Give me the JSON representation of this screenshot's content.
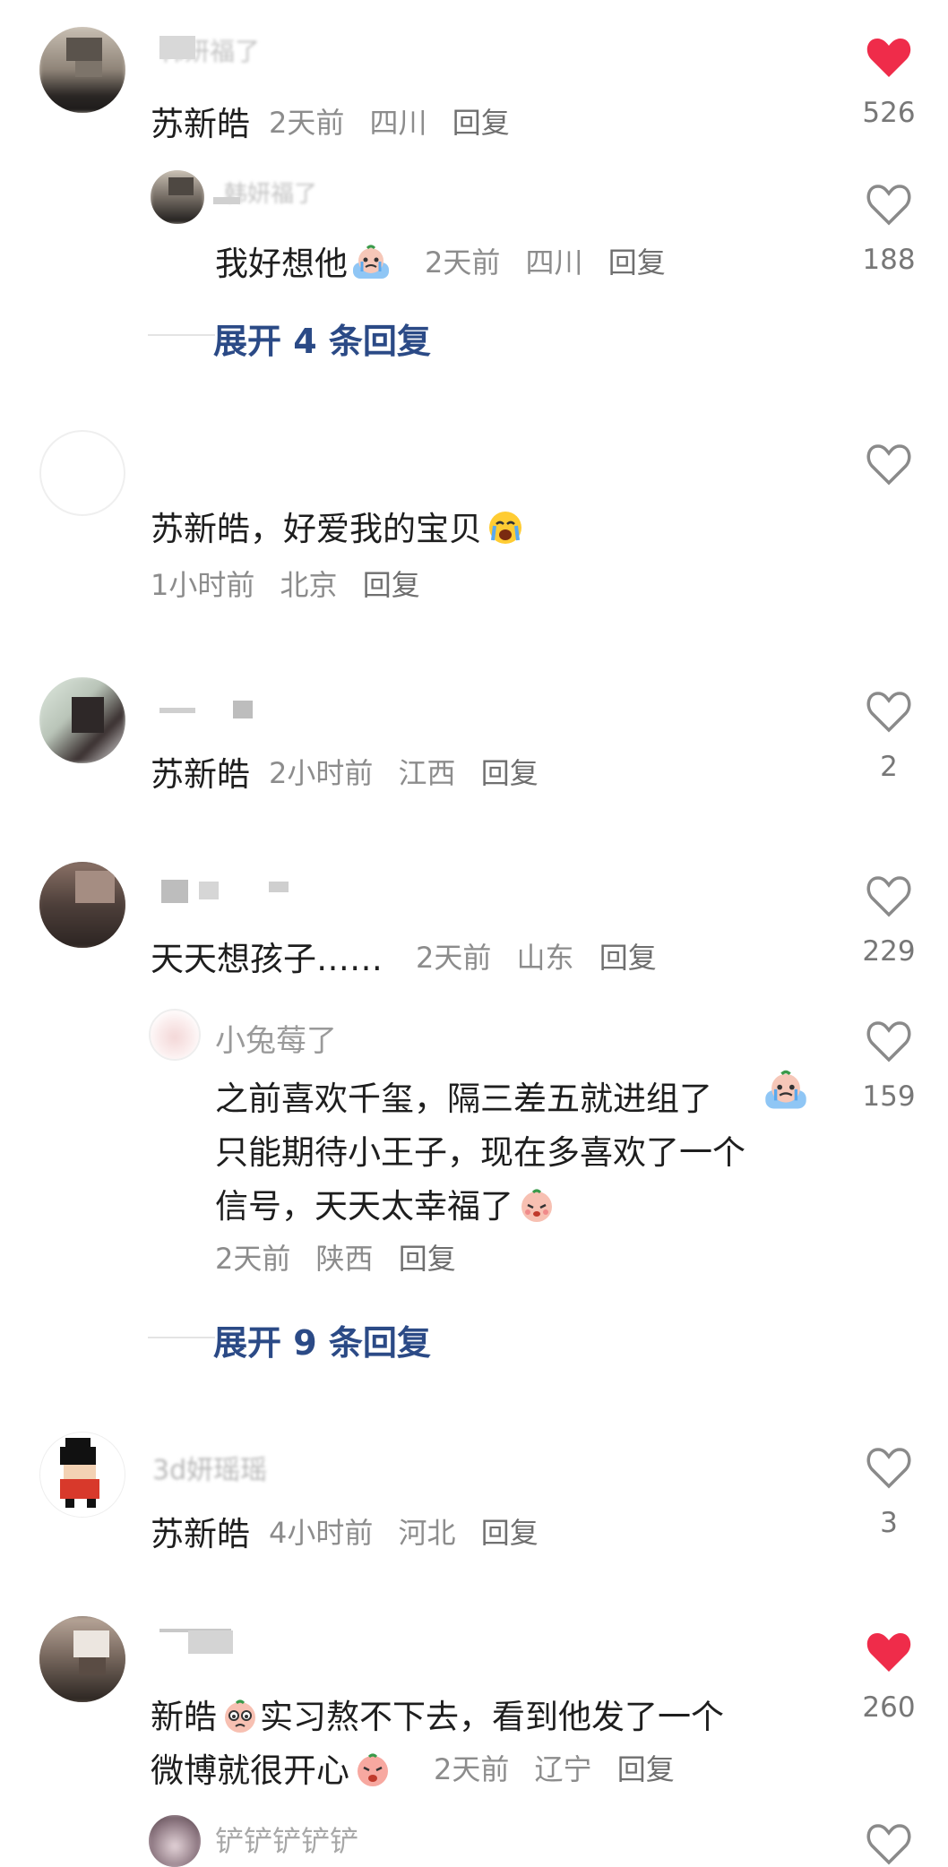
{
  "comments": [
    {
      "username": "韩妍福了",
      "text": "苏新皓",
      "time": "2天前",
      "location": "四川",
      "reply": "回复",
      "likes": "526",
      "liked": true,
      "replies": [
        {
          "username": "韩妍福了",
          "text": "我好想他",
          "time": "2天前",
          "location": "四川",
          "reply": "回复",
          "likes": "188",
          "liked": false
        }
      ],
      "expand": "展开 4 条回复"
    },
    {
      "username": "",
      "text": "苏新皓，好爱我的宝贝",
      "time": "1小时前",
      "location": "北京",
      "reply": "回复",
      "likes": "",
      "liked": false
    },
    {
      "username": "",
      "text": "苏新皓",
      "time": "2小时前",
      "location": "江西",
      "reply": "回复",
      "likes": "2",
      "liked": false
    },
    {
      "username": "",
      "text": "天天想孩子……",
      "time": "2天前",
      "location": "山东",
      "reply": "回复",
      "likes": "229",
      "liked": false,
      "replies": [
        {
          "username": "小兔莓了",
          "text_lines": [
            "之前喜欢千玺，隔三差五就进组了",
            "只能期待小王子，现在多喜欢了一个",
            "信号，天天太幸福了"
          ],
          "time": "2天前",
          "location": "陕西",
          "reply": "回复",
          "likes": "159",
          "liked": false
        }
      ],
      "expand": "展开 9 条回复"
    },
    {
      "username": "3d妍瑶瑶",
      "text": "苏新皓",
      "time": "4小时前",
      "location": "河北",
      "reply": "回复",
      "likes": "3",
      "liked": false
    },
    {
      "username": "",
      "text_lines": [
        "新皓",
        "实习熬不下去，看到他发了一个",
        "微博就很开心"
      ],
      "time": "2天前",
      "location": "辽宁",
      "reply": "回复",
      "likes": "260",
      "liked": true,
      "replies": [
        {
          "username": "铲铲铲铲铲",
          "liked": false
        }
      ]
    }
  ],
  "colors": {
    "heart_liked": "#ef2c4a",
    "heart_outline": "#8a8a8a",
    "expand_text": "#2b4a86"
  },
  "icons": {
    "heart": "heart-icon",
    "emoji_cry": "crying-emoji-icon",
    "emoji_face": "blushing-emoji-icon",
    "emoji_sad": "sad-emoji-icon"
  }
}
